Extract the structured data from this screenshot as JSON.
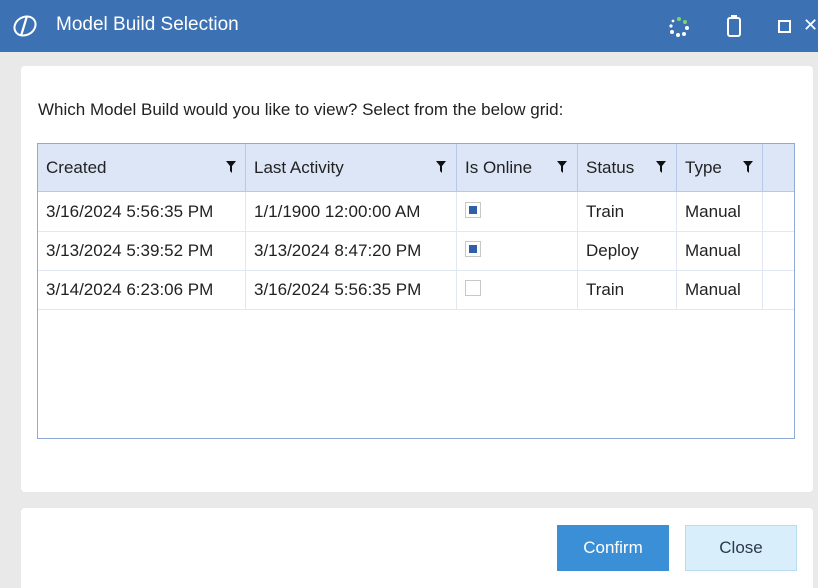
{
  "window": {
    "title": "Model Build Selection",
    "accent_color": "#3c72b4",
    "icons": [
      "app-logo-icon",
      "loading-spinner-icon",
      "battery-icon",
      "maximize-icon",
      "close-icon"
    ]
  },
  "prompt": "Which Model Build would you like to view? Select from the below grid:",
  "grid": {
    "columns": [
      {
        "label": "Created",
        "filter_icon": "filter-icon"
      },
      {
        "label": "Last Activity",
        "filter_icon": "filter-icon"
      },
      {
        "label": "Is Online",
        "filter_icon": "filter-icon"
      },
      {
        "label": "Status",
        "filter_icon": "filter-icon"
      },
      {
        "label": "Type",
        "filter_icon": "filter-icon"
      }
    ],
    "rows": [
      {
        "created": "3/16/2024 5:56:35 PM",
        "last_activity": "1/1/1900 12:00:00 AM",
        "is_online": true,
        "status": "Train",
        "type": "Manual"
      },
      {
        "created": "3/13/2024 5:39:52 PM",
        "last_activity": "3/13/2024 8:47:20 PM",
        "is_online": true,
        "status": "Deploy",
        "type": "Manual"
      },
      {
        "created": "3/14/2024 6:23:06 PM",
        "last_activity": "3/16/2024 5:56:35 PM",
        "is_online": false,
        "status": "Train",
        "type": "Manual"
      }
    ]
  },
  "buttons": {
    "confirm": "Confirm",
    "close": "Close",
    "confirm_color": "#3a8fd6",
    "close_color": "#d8eefb"
  }
}
